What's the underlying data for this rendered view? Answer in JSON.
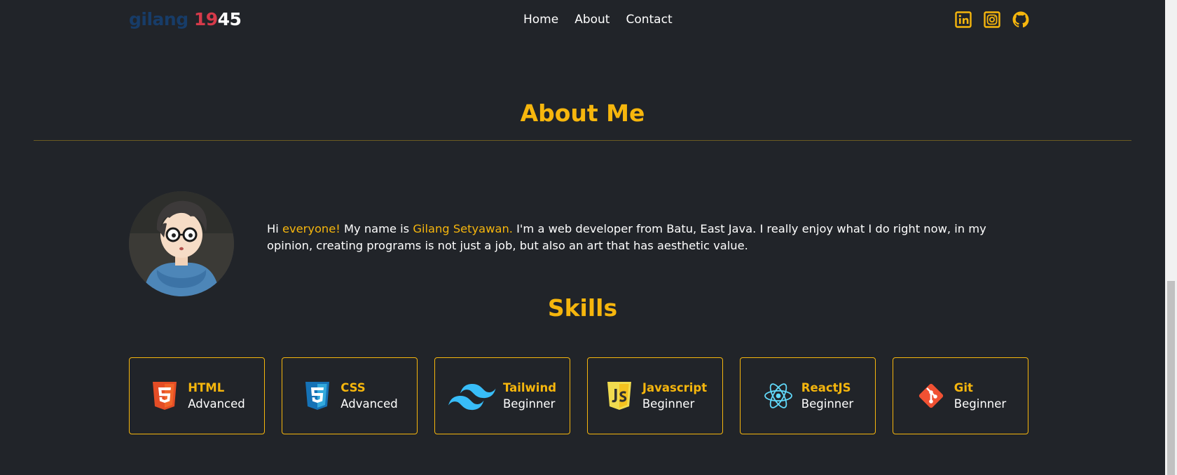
{
  "navbar": {
    "logo": {
      "part1": "gilang ",
      "part2": "19",
      "part3": "45"
    },
    "links": [
      "Home",
      "About",
      "Contact"
    ],
    "social_icons": [
      "linkedin-icon",
      "instagram-icon",
      "github-icon"
    ]
  },
  "about": {
    "title": "About Me",
    "bio": {
      "p1": "Hi ",
      "p2": "everyone!",
      "p3": " My name is ",
      "p4": "Gilang Setyawan.",
      "p5": " I'm a web developer from Batu, East Java. I really enjoy what I do right now, in my opinion, creating programs is not just a job, but also an art that has aesthetic value."
    }
  },
  "skills": {
    "title": "Skills",
    "items": [
      {
        "name": "HTML",
        "level": "Advanced",
        "icon": "html5-icon"
      },
      {
        "name": "CSS",
        "level": "Advanced",
        "icon": "css3-icon"
      },
      {
        "name": "Tailwind",
        "level": "Beginner",
        "icon": "tailwind-icon"
      },
      {
        "name": "Javascript",
        "level": "Beginner",
        "icon": "javascript-icon"
      },
      {
        "name": "ReactJS",
        "level": "Beginner",
        "icon": "react-icon"
      },
      {
        "name": "Git",
        "level": "Beginner",
        "icon": "git-icon"
      }
    ]
  },
  "colors": {
    "accent": "#f6b60d",
    "background": "#212429",
    "logo_blue": "#173c68",
    "logo_red": "#d63a4a"
  }
}
